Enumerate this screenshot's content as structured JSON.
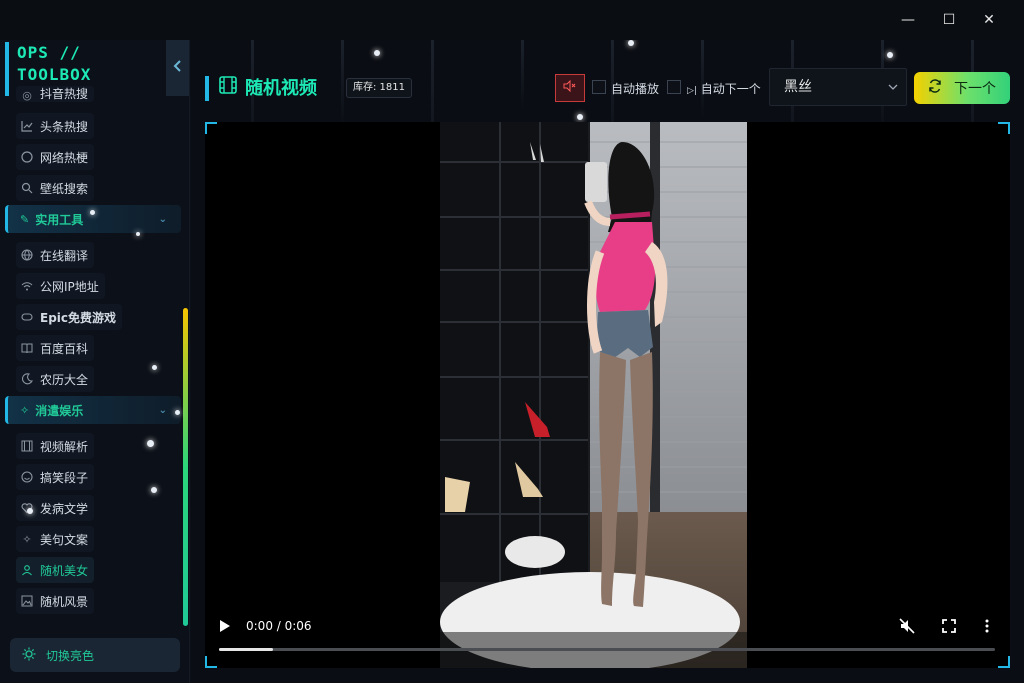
{
  "window": {
    "minimize_glyph": "—",
    "maximize_glyph": "☐",
    "close_glyph": "✕"
  },
  "sidebar": {
    "logo_line1": "OPS //",
    "logo_line2": "TOOLBOX",
    "partial_item": "抖音热搜",
    "items_top": [
      {
        "label": "头条热搜",
        "icon": "chart-line-icon"
      },
      {
        "label": "网络热梗",
        "icon": "chat-bubble-icon"
      },
      {
        "label": "壁纸搜索",
        "icon": "search-icon"
      }
    ],
    "group_tools": "实用工具",
    "items_tools": [
      {
        "label": "在线翻译",
        "icon": "globe-icon"
      },
      {
        "label": "公网IP地址",
        "icon": "wifi-icon"
      },
      {
        "label": "Epic免费游戏",
        "icon": "gamepad-icon"
      },
      {
        "label": "百度百科",
        "icon": "book-icon"
      },
      {
        "label": "农历大全",
        "icon": "moon-icon"
      }
    ],
    "group_fun": "消遣娱乐",
    "items_fun": [
      {
        "label": "视频解析",
        "icon": "film-icon"
      },
      {
        "label": "搞笑段子",
        "icon": "smile-icon"
      },
      {
        "label": "发病文学",
        "icon": "heart-icon"
      },
      {
        "label": "美句文案",
        "icon": "sparkle-icon"
      },
      {
        "label": "随机美女",
        "icon": "user-icon",
        "active": true
      },
      {
        "label": "随机风景",
        "icon": "image-icon"
      }
    ],
    "theme_button": "切换亮色"
  },
  "header": {
    "title": "随机视频",
    "stock_label": "库存: 1811",
    "autoplay_label": "自动播放",
    "autonext_label": "自动下一个",
    "category_value": "黑丝",
    "next_button": "下一个"
  },
  "player": {
    "time": "0:00 / 0:06",
    "progress": 0.07
  },
  "colors": {
    "accent": "#1de9b6",
    "highlight": "#23b7e5",
    "mute_red": "#c83b3b"
  }
}
